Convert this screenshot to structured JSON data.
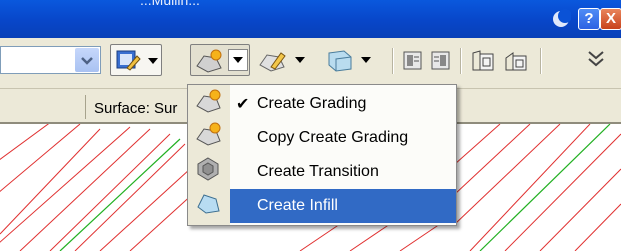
{
  "titlebar": {
    "title": "...Mullin...",
    "help_label": "?",
    "close_label": "X"
  },
  "toolbar": {
    "grading_tools": [
      "Create Grading",
      "Edit Grading",
      "Grading Group"
    ]
  },
  "status": {
    "surface_label": "Surface: Sur"
  },
  "menu": {
    "items": [
      {
        "label": "Create Grading",
        "checked": true,
        "selected": false
      },
      {
        "label": "Copy Create Grading",
        "checked": false,
        "selected": false
      },
      {
        "label": "Create Transition",
        "checked": false,
        "selected": false
      },
      {
        "label": "Create Infill",
        "checked": false,
        "selected": true
      }
    ],
    "check_glyph": "✔"
  },
  "colors": {
    "titlebar": "#0846c9",
    "toolbar_bg": "#ece9d8",
    "menu_highlight": "#316ac5",
    "contour_red": "#e03030",
    "contour_green": "#22b022"
  }
}
